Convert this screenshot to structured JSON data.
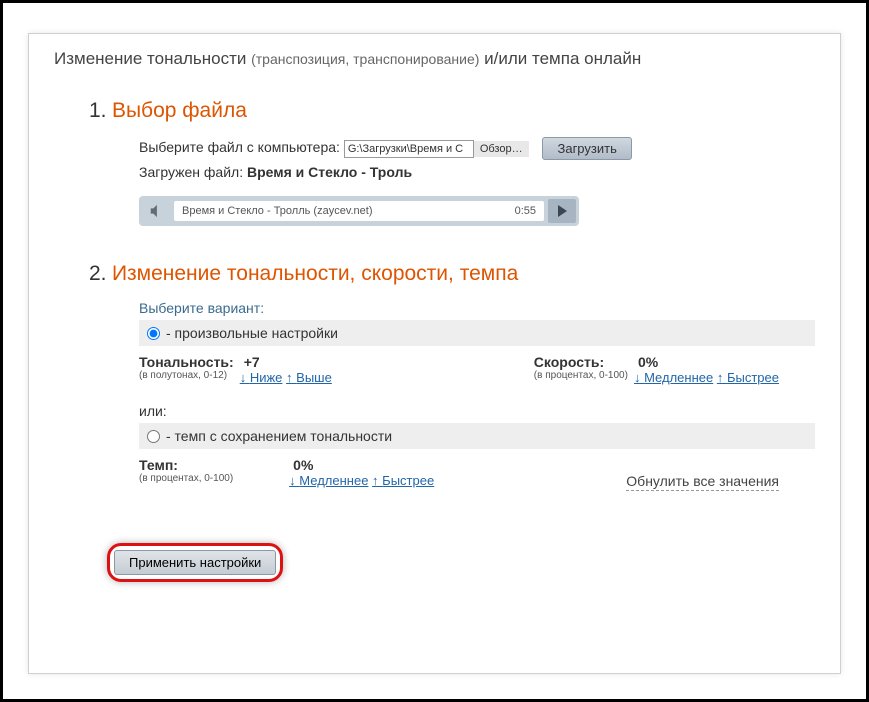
{
  "header": {
    "title_main": "Изменение тональности",
    "title_sub": "(транспозиция, транспонирование)",
    "title_tail": "и/или темпа онлайн"
  },
  "section1": {
    "number": "1.",
    "title": "Выбор файла",
    "choose_label": "Выберите файл с компьютера:",
    "file_path": "G:\\Загрузки\\Время и С",
    "browse_label": "Обзор…",
    "upload_label": "Загрузить",
    "loaded_label": "Загружен файл:",
    "loaded_file": "Время и Стекло - Троль",
    "player_track": "Время и Стекло - Тролль (zaycev.net)",
    "player_time": "0:55"
  },
  "section2": {
    "number": "2.",
    "title": "Изменение тональности, скорости, темпа",
    "choose_variant": "Выберите вариант:",
    "radio1_label": "- произвольные настройки",
    "tone": {
      "label": "Тональность:",
      "value": "+7",
      "hint": "(в полутонах, 0-12)",
      "lower": "Ниже",
      "higher": "Выше"
    },
    "speed": {
      "label": "Скорость:",
      "value": "0%",
      "hint": "(в процентах, 0-100)",
      "slower": "Медленнее",
      "faster": "Быстрее"
    },
    "or_label": "или:",
    "radio2_label": "- темп с сохранением тональности",
    "tempo": {
      "label": "Темп:",
      "value": "0%",
      "hint": "(в процентах, 0-100)",
      "slower": "Медленнее",
      "faster": "Быстрее"
    },
    "reset_label": "Обнулить все значения"
  },
  "apply": {
    "label": "Применить настройки"
  }
}
